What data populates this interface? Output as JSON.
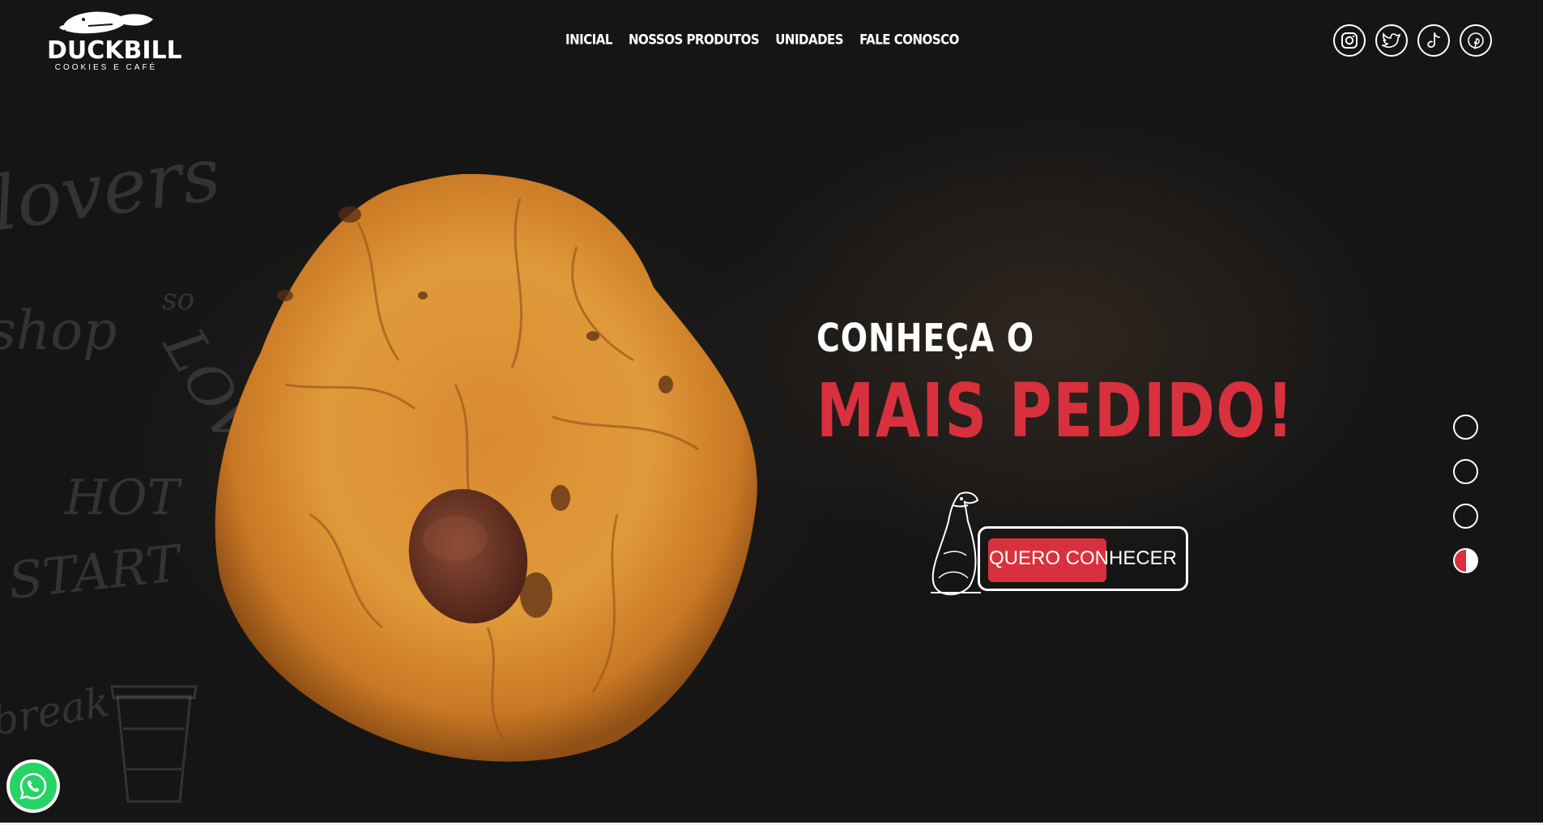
{
  "brand": {
    "name": "DUCKBILL",
    "tagline": "COOKIES E CAFÉ"
  },
  "nav": {
    "items": [
      {
        "label": "INICIAL"
      },
      {
        "label": "NOSSOS PRODUTOS"
      },
      {
        "label": "UNIDADES"
      },
      {
        "label": "FALE CONOSCO"
      }
    ]
  },
  "socials": [
    {
      "icon": "instagram-icon"
    },
    {
      "icon": "twitter-icon"
    },
    {
      "icon": "tiktok-icon"
    },
    {
      "icon": "pinterest-icon"
    }
  ],
  "hero": {
    "line1": "CONHEÇA O",
    "line2": "MAIS PEDIDO!",
    "cta_label": "QUERO CONHECER"
  },
  "slider": {
    "count": 4,
    "active_index": 3
  },
  "colors": {
    "accent": "#d8313d",
    "background": "#151515",
    "text": "#ffffff",
    "whatsapp": "#25d366"
  },
  "background_sketch": [
    "lovers",
    "shop",
    "so",
    "HOT",
    "START",
    "LOVE",
    "break"
  ]
}
